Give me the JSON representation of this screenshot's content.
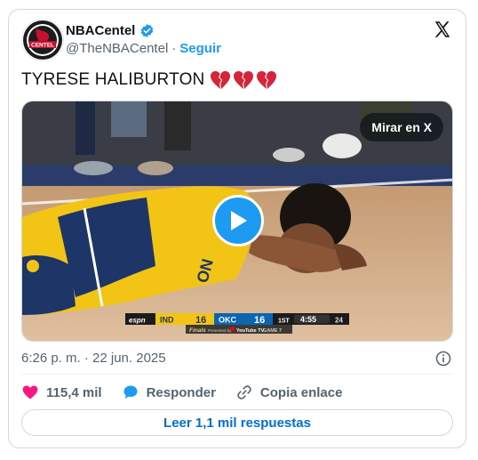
{
  "author": {
    "display_name": "NBACentel",
    "handle": "@TheNBACentel",
    "separator": "·",
    "follow_label": "Seguir",
    "avatar_text": "CENTEL"
  },
  "tweet": {
    "text": "TYRESE HALIBURTON",
    "emoji": [
      "💔",
      "💔",
      "💔"
    ]
  },
  "media": {
    "watch_label": "Mirar en X",
    "scoreboard": {
      "network": "espn",
      "team1": "IND",
      "score1": "16",
      "team2": "OKC",
      "score2": "16",
      "quarter": "1ST",
      "clock": "4:55",
      "shot_clock": "24",
      "sub_left": "Finals",
      "sub_presented": "Presented by",
      "sub_brand": "YouTube TV",
      "sub_game": "GAME 7"
    },
    "jersey_text": "ON"
  },
  "timestamp": "6:26 p. m. · 22 jun. 2025",
  "actions": {
    "likes": "115,4 mil",
    "reply_label": "Responder",
    "copy_label": "Copia enlace"
  },
  "read_replies_label": "Leer 1,1 mil respuestas",
  "colors": {
    "accent": "#1d9bf0",
    "like": "#f91880",
    "heart_emoji": "#d6243a"
  }
}
